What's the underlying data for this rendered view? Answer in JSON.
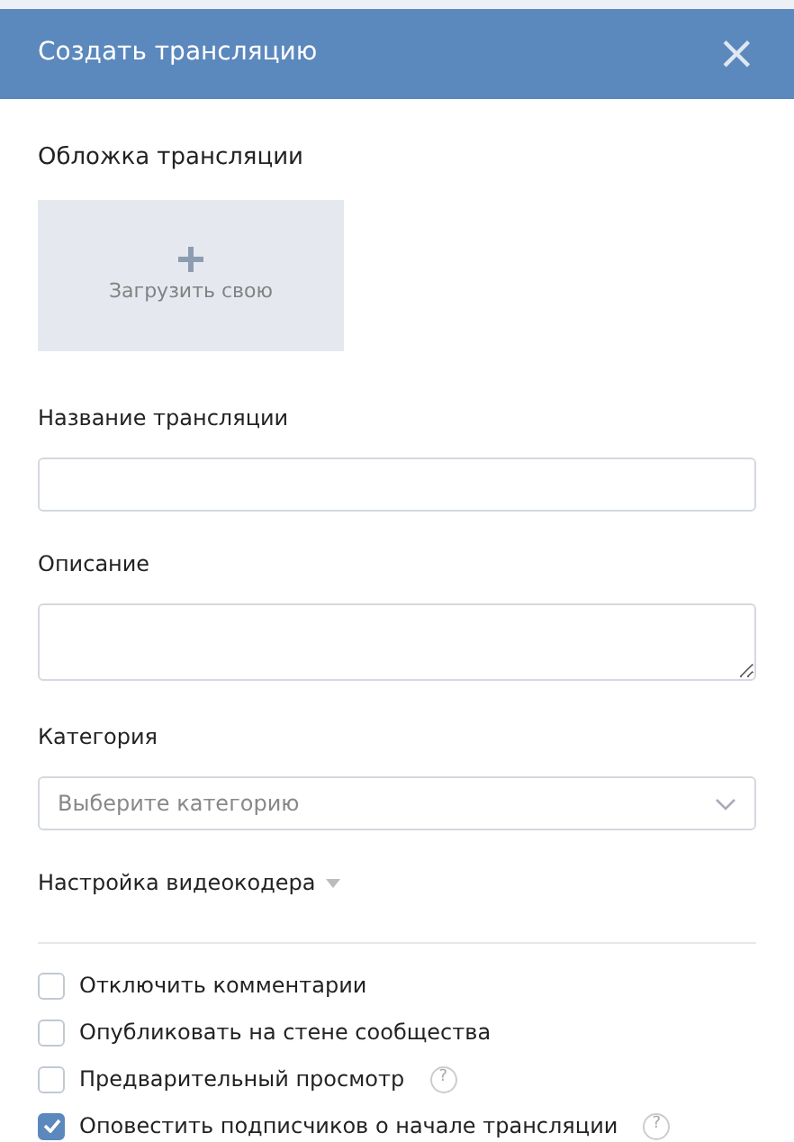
{
  "window": {
    "title": "Создать трансляцию",
    "close": "×"
  },
  "cover": {
    "label": "Обложка трансляции",
    "upload": "Загрузить свою"
  },
  "name_field": {
    "label": "Название трансляции"
  },
  "description_field": {
    "label": "Описание"
  },
  "category": {
    "label": "Категория",
    "placeholder": "Выберите категорию"
  },
  "encoder": {
    "label": "Настройка видеокодера",
    "expanded": false
  },
  "options": [
    {
      "label": "Отключить комментарии",
      "checked": false
    },
    {
      "label": "Опубликовать на стене сообщества",
      "checked": false
    },
    {
      "label": "Предварительный просмотр",
      "checked": false,
      "help": "?"
    },
    {
      "label": "Оповестить подписчиков о начале трансляции",
      "checked": true,
      "help": "?"
    }
  ]
}
